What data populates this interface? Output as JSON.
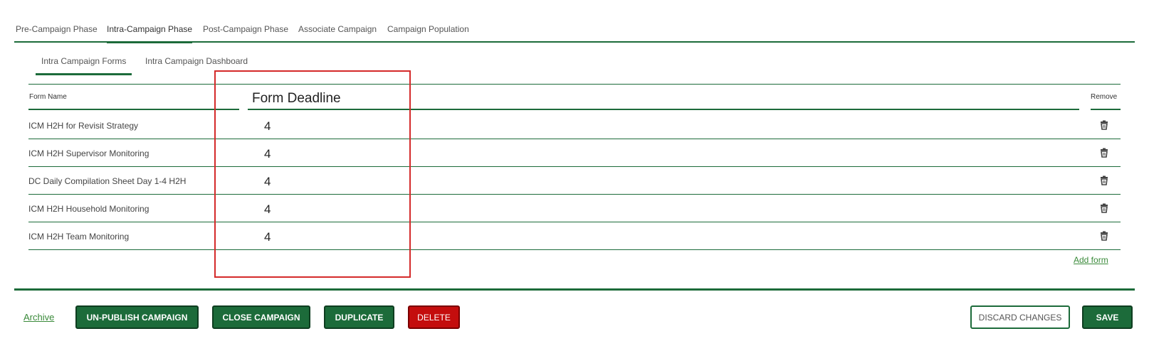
{
  "top_tabs": [
    {
      "label": "Pre-Campaign Phase"
    },
    {
      "label": "Intra-Campaign Phase"
    },
    {
      "label": "Post-Campaign Phase"
    },
    {
      "label": "Associate Campaign"
    },
    {
      "label": "Campaign Population"
    }
  ],
  "sub_tabs": [
    {
      "label": "Intra Campaign Forms"
    },
    {
      "label": "Intra Campaign Dashboard"
    }
  ],
  "table": {
    "headers": {
      "form_name": "Form Name",
      "form_deadline": "Form Deadline",
      "remove": "Remove"
    },
    "rows": [
      {
        "name": "ICM H2H for Revisit Strategy",
        "deadline": "4"
      },
      {
        "name": "ICM H2H Supervisor Monitoring",
        "deadline": "4"
      },
      {
        "name": "DC Daily Compilation Sheet Day 1-4 H2H",
        "deadline": "4"
      },
      {
        "name": "ICM H2H Household Monitoring",
        "deadline": "4"
      },
      {
        "name": "ICM H2H Team Monitoring",
        "deadline": "4"
      }
    ],
    "add_form": "Add form"
  },
  "footer": {
    "archive": "Archive",
    "unpublish": "UN-PUBLISH CAMPAIGN",
    "close": "CLOSE CAMPAIGN",
    "duplicate": "DUPLICATE",
    "delete": "DELETE",
    "discard": "DISCARD CHANGES",
    "save": "SAVE"
  },
  "colors": {
    "accent": "#1c6b3a",
    "danger": "#c40d0d",
    "highlight": "#d42a2a"
  }
}
